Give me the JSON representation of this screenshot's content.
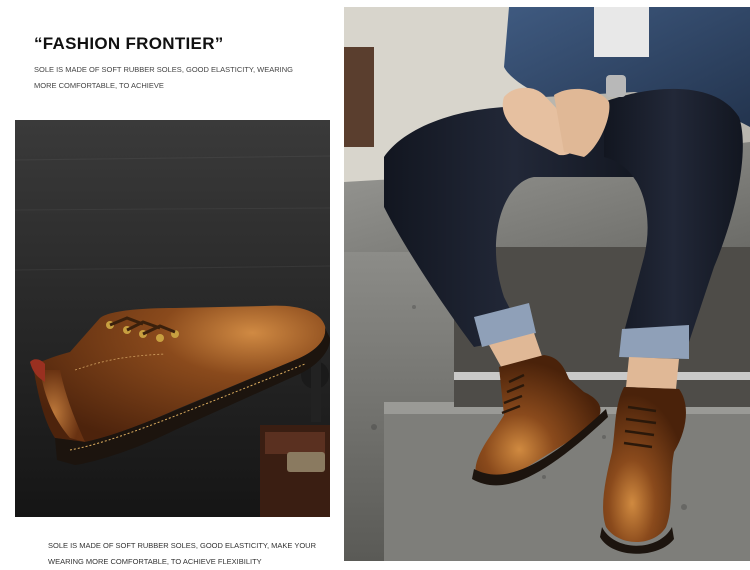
{
  "header": {
    "title": "“FASHION FRONTIER”",
    "description": "SOLE IS MADE OF SOFT RUBBER SOLES, GOOD ELASTICITY, WEARING MORE COMFORTABLE, TO ACHIEVE"
  },
  "footer": {
    "description": "SOLE IS MADE OF SOFT RUBBER SOLES, GOOD ELASTICITY, MAKE YOUR WEARING MORE COMFORTABLE, TO ACHIEVE FLEXIBILITY"
  },
  "images": {
    "left": "product-photo-brown-leather-boot-closeup",
    "right": "lifestyle-photo-man-in-jeans-wearing-boots-on-stone-steps"
  },
  "colors": {
    "leather": "#7a3c16",
    "leather_highlight": "#c8823c",
    "denim": "#1b2030",
    "stone": "#8a8a86"
  }
}
